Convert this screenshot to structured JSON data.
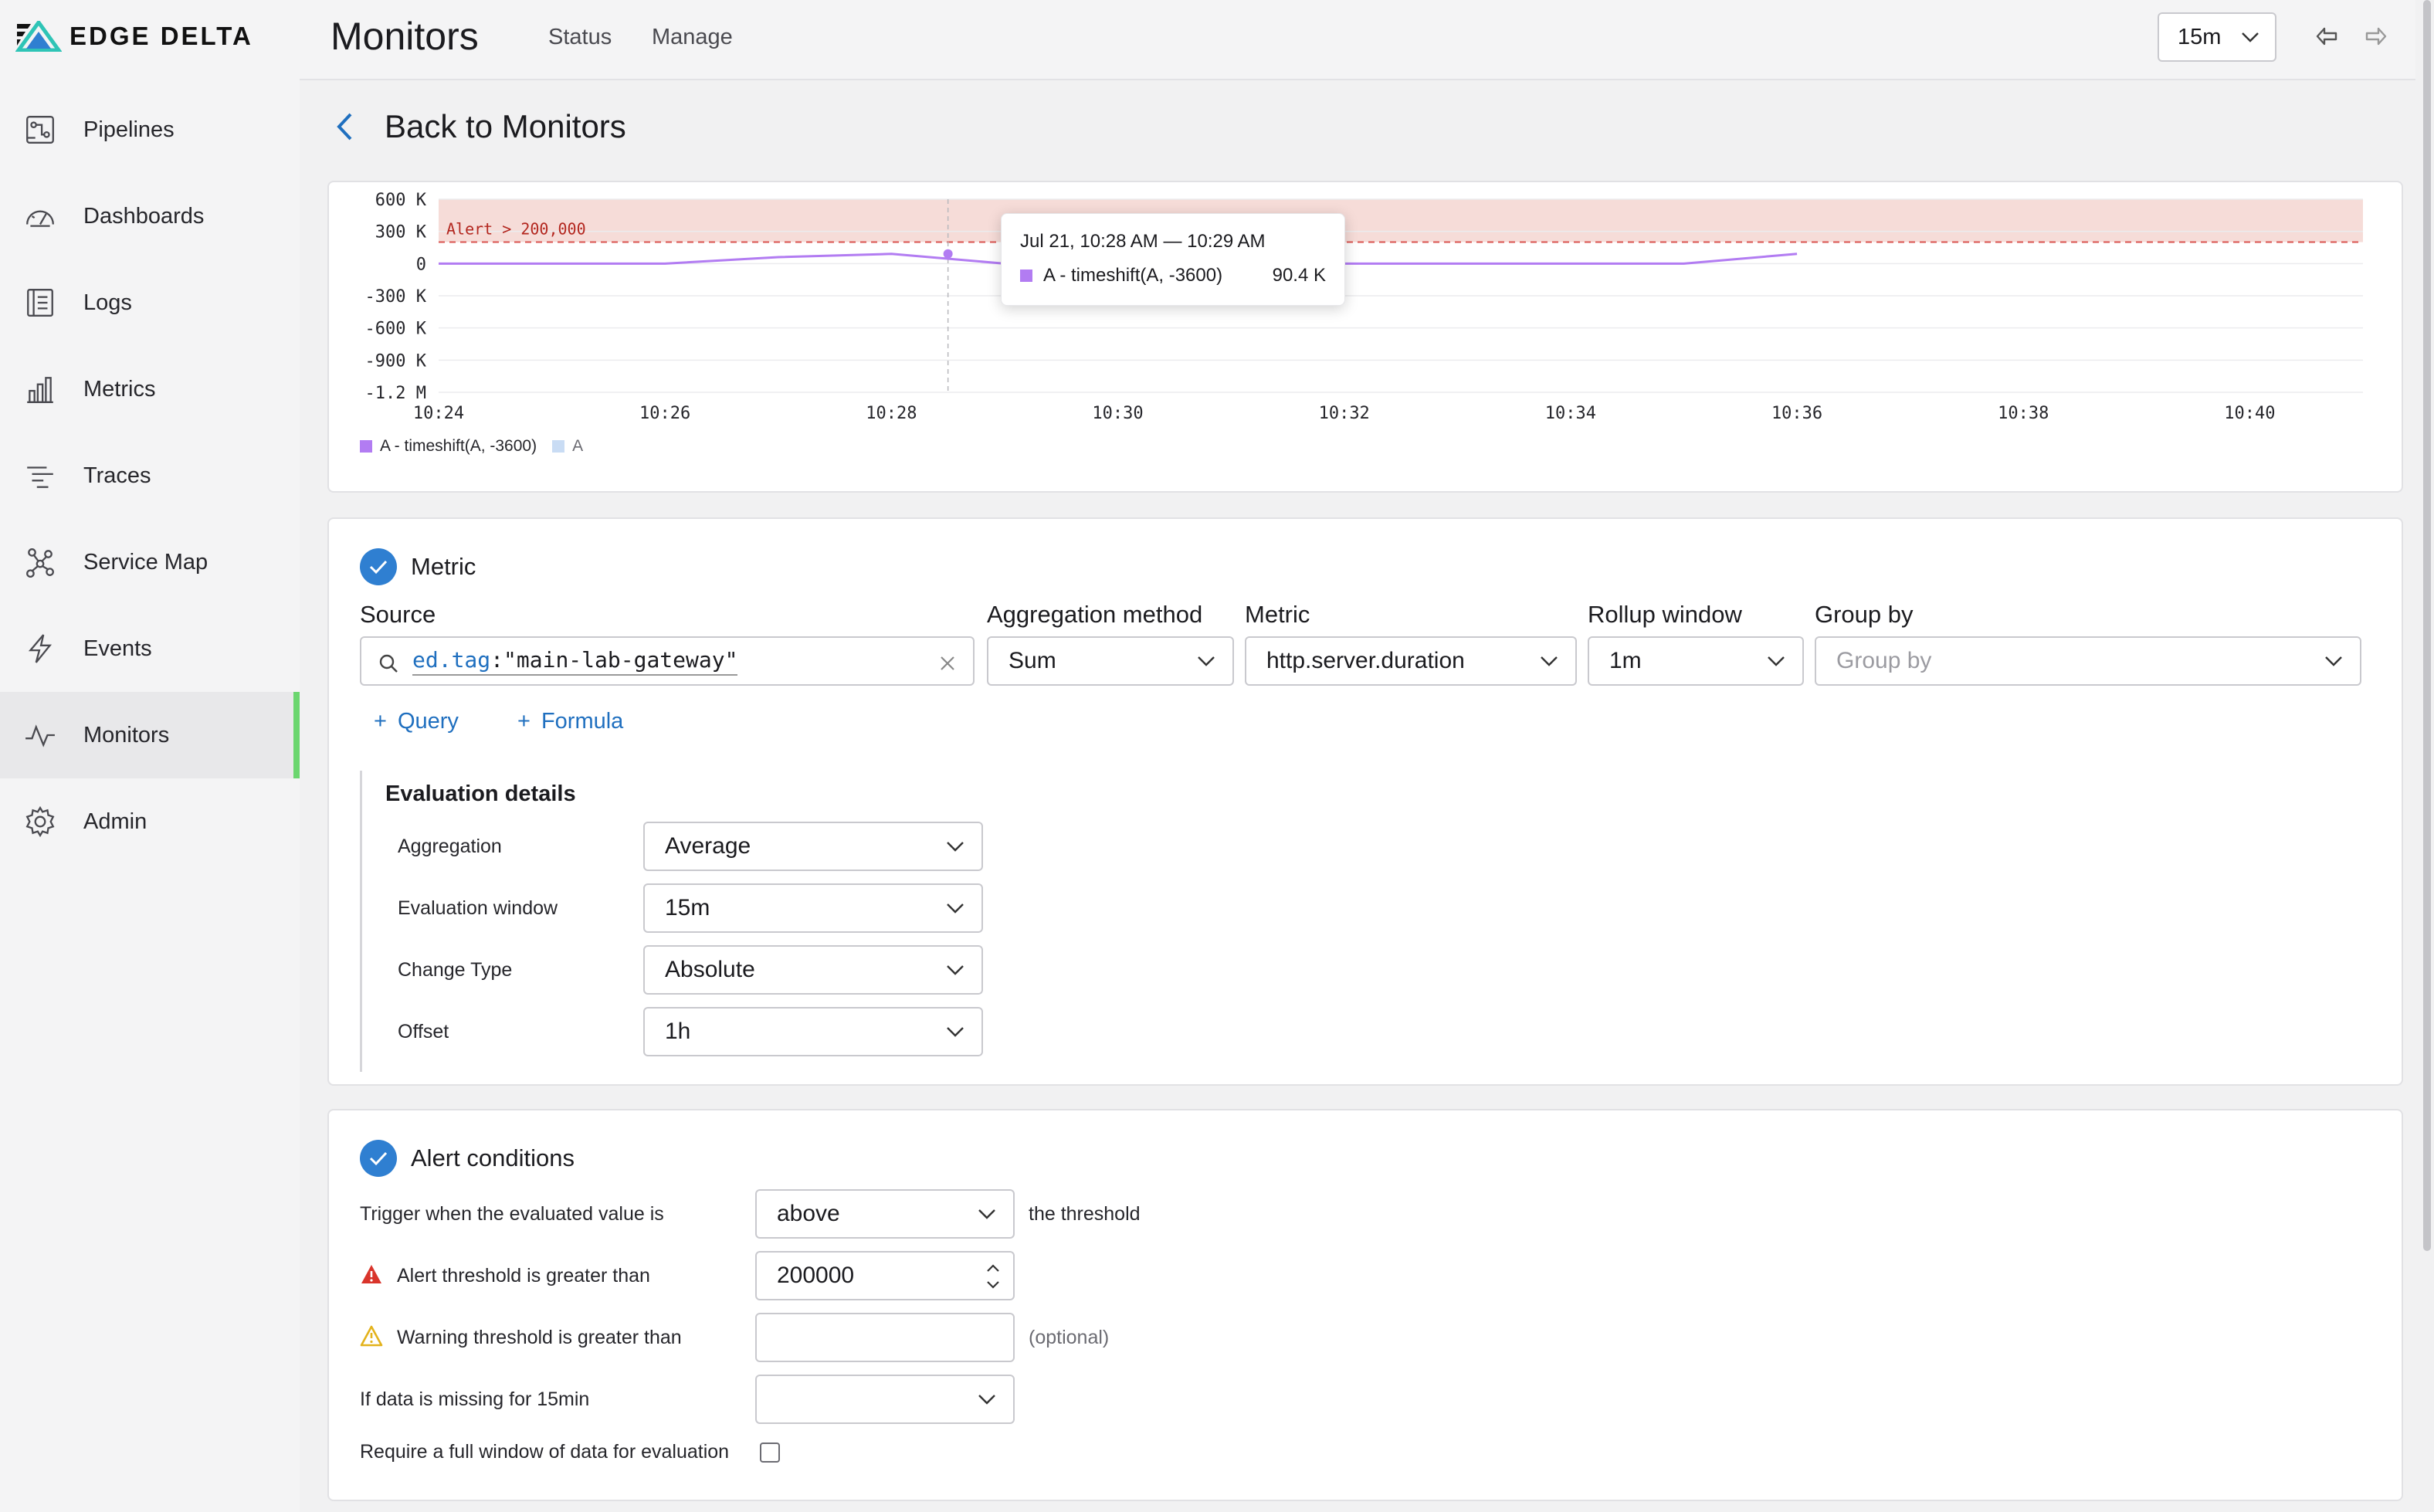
{
  "brand": {
    "name": "EDGE DELTA"
  },
  "sidebar": {
    "items": [
      {
        "label": "Pipelines",
        "icon": "pipelines-icon"
      },
      {
        "label": "Dashboards",
        "icon": "dashboard-gauge-icon"
      },
      {
        "label": "Logs",
        "icon": "logs-icon"
      },
      {
        "label": "Metrics",
        "icon": "bar-chart-icon"
      },
      {
        "label": "Traces",
        "icon": "traces-icon"
      },
      {
        "label": "Service Map",
        "icon": "service-map-icon"
      },
      {
        "label": "Events",
        "icon": "lightning-icon"
      },
      {
        "label": "Monitors",
        "icon": "pulse-icon",
        "active": true
      },
      {
        "label": "Admin",
        "icon": "gear-icon"
      }
    ]
  },
  "header": {
    "title": "Monitors",
    "tabs": [
      "Status",
      "Manage"
    ],
    "time_range": "15m"
  },
  "back_label": "Back to Monitors",
  "chart": {
    "tooltip": {
      "time": "Jul 21, 10:28 AM — 10:29 AM",
      "series": "A - timeshift(A, -3600)",
      "value": "90.4 K"
    },
    "legend": [
      "A - timeshift(A, -3600)",
      "A"
    ],
    "alert_label": "Alert > 200,000"
  },
  "chart_data": {
    "type": "line",
    "x": [
      "10:24",
      "10:25",
      "10:26",
      "10:27",
      "10:28",
      "10:29",
      "10:30",
      "10:31",
      "10:32",
      "10:33",
      "10:34",
      "10:35",
      "10:36"
    ],
    "series": [
      {
        "name": "A - timeshift(A, -3600)",
        "color": "#b27cf2",
        "values": [
          0,
          0,
          0,
          60000,
          90400,
          0,
          0,
          0,
          0,
          0,
          0,
          0,
          90400
        ]
      }
    ],
    "x_ticks": [
      "10:24",
      "10:26",
      "10:28",
      "10:30",
      "10:32",
      "10:34",
      "10:36",
      "10:38",
      "10:40"
    ],
    "y_ticks": [
      "600 K",
      "300 K",
      "0",
      "-300 K",
      "-600 K",
      "-900 K",
      "-1.2 M"
    ],
    "y_tick_values": [
      600000,
      300000,
      0,
      -300000,
      -600000,
      -900000,
      -1200000
    ],
    "threshold": 200000,
    "threshold_color": "#d9534f",
    "alert_fill": "#f6dcd8"
  },
  "metric": {
    "section_title": "Metric",
    "source_label": "Source",
    "source_query_key": "ed.tag",
    "source_query_sep": ":",
    "source_query_value": "\"main-lab-gateway\"",
    "aggregation_method_label": "Aggregation method",
    "aggregation_method": "Sum",
    "metric_label": "Metric",
    "metric_value": "http.server.duration",
    "rollup_label": "Rollup window",
    "rollup_value": "1m",
    "group_by_label": "Group by",
    "group_by_placeholder": "Group by",
    "add_query": "Query",
    "add_formula": "Formula"
  },
  "evaluation": {
    "title": "Evaluation details",
    "rows": [
      {
        "label": "Aggregation",
        "value": "Average"
      },
      {
        "label": "Evaluation window",
        "value": "15m"
      },
      {
        "label": "Change Type",
        "value": "Absolute"
      },
      {
        "label": "Offset",
        "value": "1h"
      }
    ]
  },
  "alert": {
    "section_title": "Alert conditions",
    "trigger_label": "Trigger when the evaluated value is",
    "trigger_value": "above",
    "trigger_suffix": "the threshold",
    "alert_threshold_label": "Alert threshold is greater than",
    "alert_threshold_value": "200000",
    "warning_threshold_label": "Warning threshold is greater than",
    "warning_optional": "(optional)",
    "missing_label": "If data is missing for 15min",
    "full_window_label": "Require a full window of data for evaluation"
  },
  "colors": {
    "accent": "#2f7fd1",
    "active_bar": "#6bd66f",
    "link": "#1f6fbf"
  }
}
